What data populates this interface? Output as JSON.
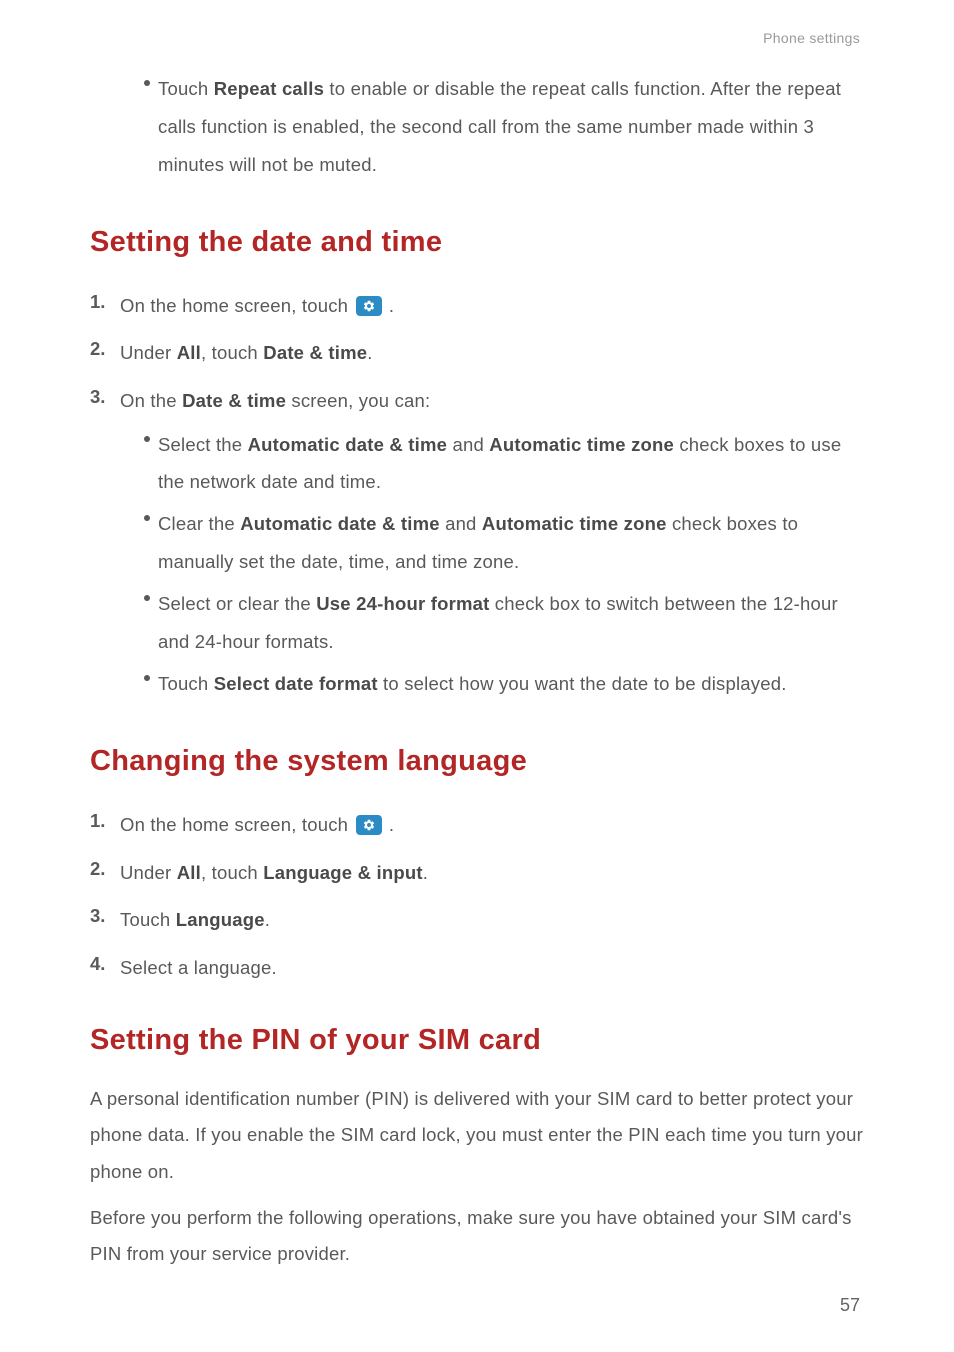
{
  "header": {
    "breadcrumb": "Phone settings"
  },
  "intro_bullet": {
    "pre": "Touch ",
    "bold": "Repeat calls",
    "post": " to enable or disable the repeat calls function. After the repeat calls function is enabled, the second call from the same number made within 3 minutes will not be muted."
  },
  "section1": {
    "title": "Setting the date and time",
    "step1": {
      "num": "1.",
      "pre": "On the home screen, touch ",
      "post": " ."
    },
    "step2": {
      "num": "2.",
      "pre": "Under ",
      "b1": "All",
      "mid": ", touch ",
      "b2": "Date & time",
      "post": "."
    },
    "step3": {
      "num": "3.",
      "pre": "On the ",
      "b1": "Date & time",
      "post": " screen, you can:"
    },
    "bullets": {
      "b1": {
        "pre": "Select the ",
        "bold1": "Automatic date & time",
        "mid": " and ",
        "bold2": "Automatic time zone",
        "post": " check boxes to use the network date and time."
      },
      "b2": {
        "pre": "Clear the ",
        "bold1": "Automatic date & time",
        "mid": " and ",
        "bold2": "Automatic time zone",
        "post": " check boxes to manually set the date, time, and time zone."
      },
      "b3": {
        "pre": "Select or clear the ",
        "bold1": "Use 24-hour format",
        "post": " check box to switch between the 12-hour and 24-hour formats."
      },
      "b4": {
        "pre": "Touch ",
        "bold1": "Select date format",
        "post": " to select how you want the date to be displayed."
      }
    }
  },
  "section2": {
    "title": "Changing the system language",
    "step1": {
      "num": "1.",
      "pre": "On the home screen, touch ",
      "post": " ."
    },
    "step2": {
      "num": "2.",
      "pre": "Under ",
      "b1": "All",
      "mid": ", touch ",
      "b2": "Language & input",
      "post": "."
    },
    "step3": {
      "num": "3.",
      "pre": "Touch ",
      "b1": "Language",
      "post": "."
    },
    "step4": {
      "num": "4.",
      "text": "Select a language."
    }
  },
  "section3": {
    "title": "Setting the PIN of your SIM card",
    "para1": "A personal identification number (PIN) is delivered with your SIM card to better protect your phone data. If you enable the SIM card lock, you must enter the PIN each time you turn your phone on.",
    "para2": "Before you perform the following operations, make sure you have obtained your SIM card's PIN from your service provider."
  },
  "page_number": "57"
}
